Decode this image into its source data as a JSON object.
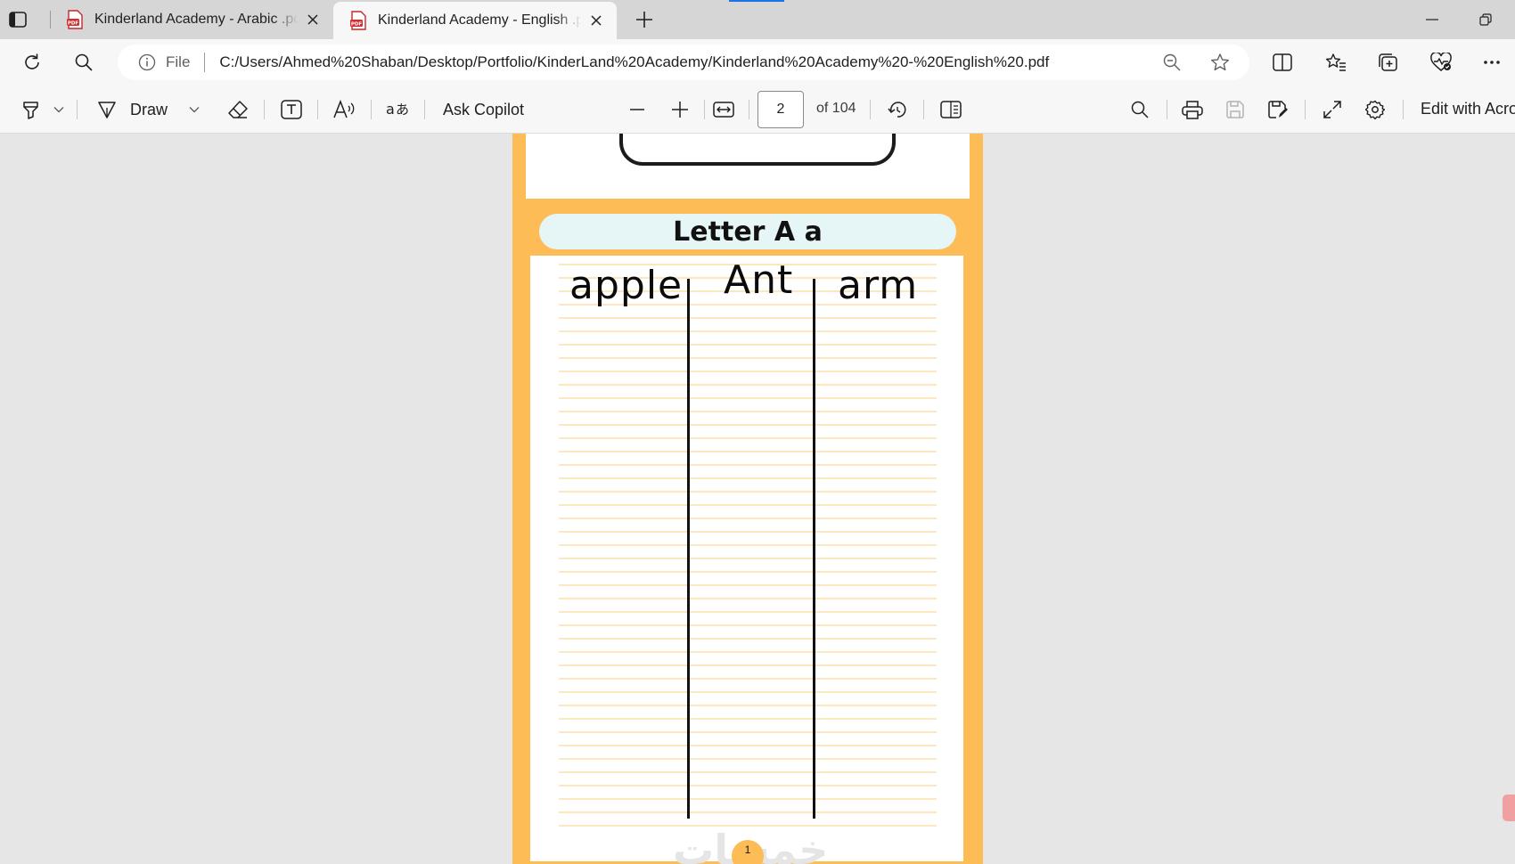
{
  "browser": {
    "tabs": [
      {
        "title": "Kinderland Academy - Arabic .pdf",
        "icon": "pdf-file-icon",
        "active": false
      },
      {
        "title": "Kinderland Academy - English .pdf",
        "icon": "pdf-file-icon",
        "active": true
      }
    ],
    "address": {
      "scheme_label": "File",
      "url": "C:/Users/Ahmed%20Shaban/Desktop/Portfolio/KinderLand%20Academy/Kinderland%20Academy%20-%20English%20.pdf"
    }
  },
  "pdf_toolbar": {
    "draw_label": "Draw",
    "copilot_label": "Ask Copilot",
    "page_current": "2",
    "page_total_label": "of 104",
    "edit_label": "Edit with Acrobat"
  },
  "document": {
    "title": "Letter A a",
    "words": [
      "apple",
      "Ant",
      "arm"
    ],
    "watermark": "خمسات",
    "page_number": "1",
    "accent_color": "#fdbc56",
    "line_color": "#fcd79a"
  }
}
